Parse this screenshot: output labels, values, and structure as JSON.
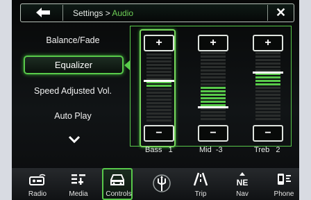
{
  "header": {
    "breadcrumb_parent": "Settings",
    "breadcrumb_sep": " > ",
    "breadcrumb_current": "Audio",
    "close_label": "✕",
    "back_icon": "back-arrow-icon"
  },
  "menu": {
    "items": [
      {
        "label": "Balance/Fade"
      },
      {
        "label": "Equalizer",
        "selected": true
      },
      {
        "label": "Speed Adjusted Vol."
      },
      {
        "label": "Auto Play"
      }
    ],
    "more_icon": "chevron-down-icon"
  },
  "equalizer": {
    "plus_label": "+",
    "minus_label": "−",
    "bands": [
      {
        "name": "Bass",
        "value": "1",
        "selected": true
      },
      {
        "name": "Mid",
        "value": "-3",
        "selected": false
      },
      {
        "name": "Treb",
        "value": "2",
        "selected": false
      }
    ]
  },
  "nav": {
    "items": [
      {
        "label": "Radio",
        "icon": "radio-icon"
      },
      {
        "label": "Media",
        "icon": "media-icon"
      },
      {
        "label": "Controls",
        "icon": "car-icon",
        "active": true
      },
      {
        "label": "Trip",
        "icon": "road-icon"
      },
      {
        "label": "Nav",
        "icon": "compass-icon"
      },
      {
        "label": "Phone",
        "icon": "phone-icon"
      }
    ],
    "compass_text": "NE"
  },
  "colors": {
    "accent": "#58c94a",
    "background": "#0a0b0c",
    "outline": "#dfe4df"
  }
}
